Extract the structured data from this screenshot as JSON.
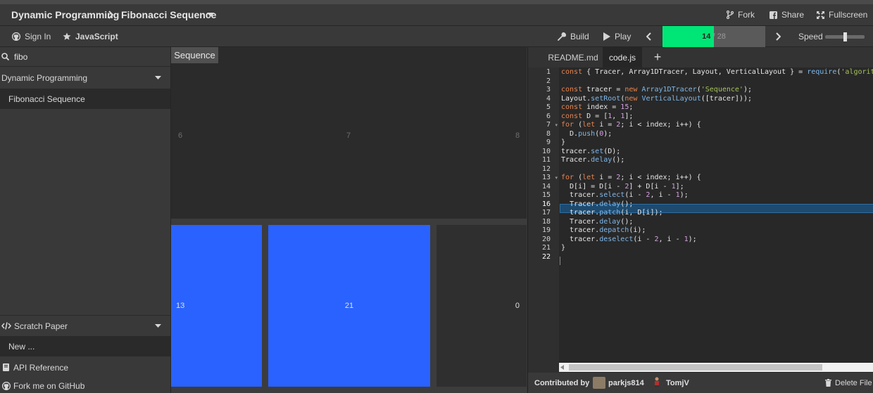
{
  "header": {
    "breadcrumb_category": "Dynamic Programming",
    "breadcrumb_algorithm": "Fibonacci Sequence",
    "fork_label": "Fork",
    "share_label": "Share",
    "fullscreen_label": "Fullscreen"
  },
  "toolbar": {
    "sign_in_label": "Sign In",
    "language_label": "JavaScript",
    "build_label": "Build",
    "play_label": "Play",
    "progress_current": "14",
    "progress_sep": " / ",
    "progress_total": "28",
    "progress_fraction": 0.5,
    "speed_label": "Speed",
    "speed_level": 0.5
  },
  "sidebar": {
    "search_value": "fibo",
    "category_label": "Dynamic Programming",
    "algorithm_item": "Fibonacci Sequence",
    "scratch_label": "Scratch Paper",
    "new_label": "New ...",
    "api_label": "API Reference",
    "github_label": "Fork me on GitHub"
  },
  "viz": {
    "title": "Sequence",
    "top_indices": [
      "6",
      "7",
      "8"
    ],
    "cells": [
      "13",
      "21",
      "0"
    ]
  },
  "editor": {
    "tabs": [
      "README.md",
      "code.js"
    ],
    "add_tab": "+",
    "active_line": 16,
    "line_numbers": [
      "1",
      "2",
      "3",
      "4",
      "5",
      "6",
      "7",
      "8",
      "9",
      "10",
      "11",
      "12",
      "13",
      "14",
      "15",
      "16",
      "17",
      "18",
      "19",
      "20",
      "21",
      "22"
    ]
  },
  "footer": {
    "contributed_label": "Contributed by",
    "contributors": [
      "parkjs814",
      "TomjV"
    ],
    "delete_label": "Delete File"
  },
  "colors": {
    "accent_green": "#00e676",
    "cell_blue": "#2962ff",
    "selection": "#1e4a6e"
  }
}
